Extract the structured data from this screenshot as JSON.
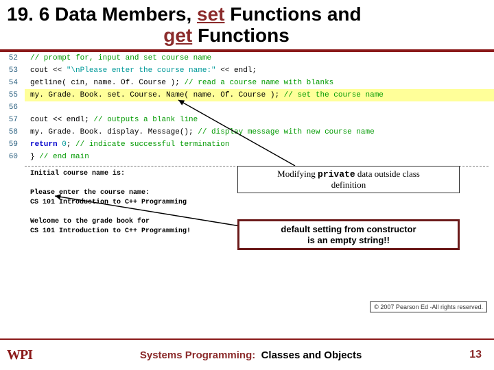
{
  "title": {
    "section": "19. 6 Data Members, ",
    "set": "set",
    "mid": " Functions and",
    "get": "get",
    "tail": " Functions"
  },
  "code": [
    {
      "n": "52",
      "c": "// prompt for, input and set course name"
    },
    {
      "n": "53",
      "c": "cout << \"\\nPlease enter the course name:\" << endl;"
    },
    {
      "n": "54",
      "c": "getline( cin, name. Of. Course ); // read a course name with blanks"
    },
    {
      "n": "55",
      "c": "my. Grade. Book. set. Course. Name( name. Of. Course ); // set the course name"
    },
    {
      "n": "56",
      "c": ""
    },
    {
      "n": "57",
      "c": "cout << endl; // outputs a blank line"
    },
    {
      "n": "58",
      "c": "my. Grade. Book. display. Message(); // display message with new course name"
    },
    {
      "n": "59",
      "c": "return 0; // indicate successful termination"
    },
    {
      "n": "60",
      "c": "} // end main"
    }
  ],
  "runtext": "Initial course name is:\n\nPlease enter the course name:\nCS 101 Introduction to C++ Programming\n\nWelcome to the grade book for\nCS 101 Introduction to C++ Programming!",
  "callout1": {
    "pre": "Modifying ",
    "kw": "private",
    "post": " data outside class",
    "line2": "definition"
  },
  "callout2": {
    "l1": "default setting from constructor",
    "l2": "is an empty string!!"
  },
  "copyright": "© 2007 Pearson Ed -All rights reserved.",
  "footer": {
    "logo": "WPI",
    "textA": "Systems Programming:",
    "textB": "Classes and Objects",
    "page": "13"
  }
}
